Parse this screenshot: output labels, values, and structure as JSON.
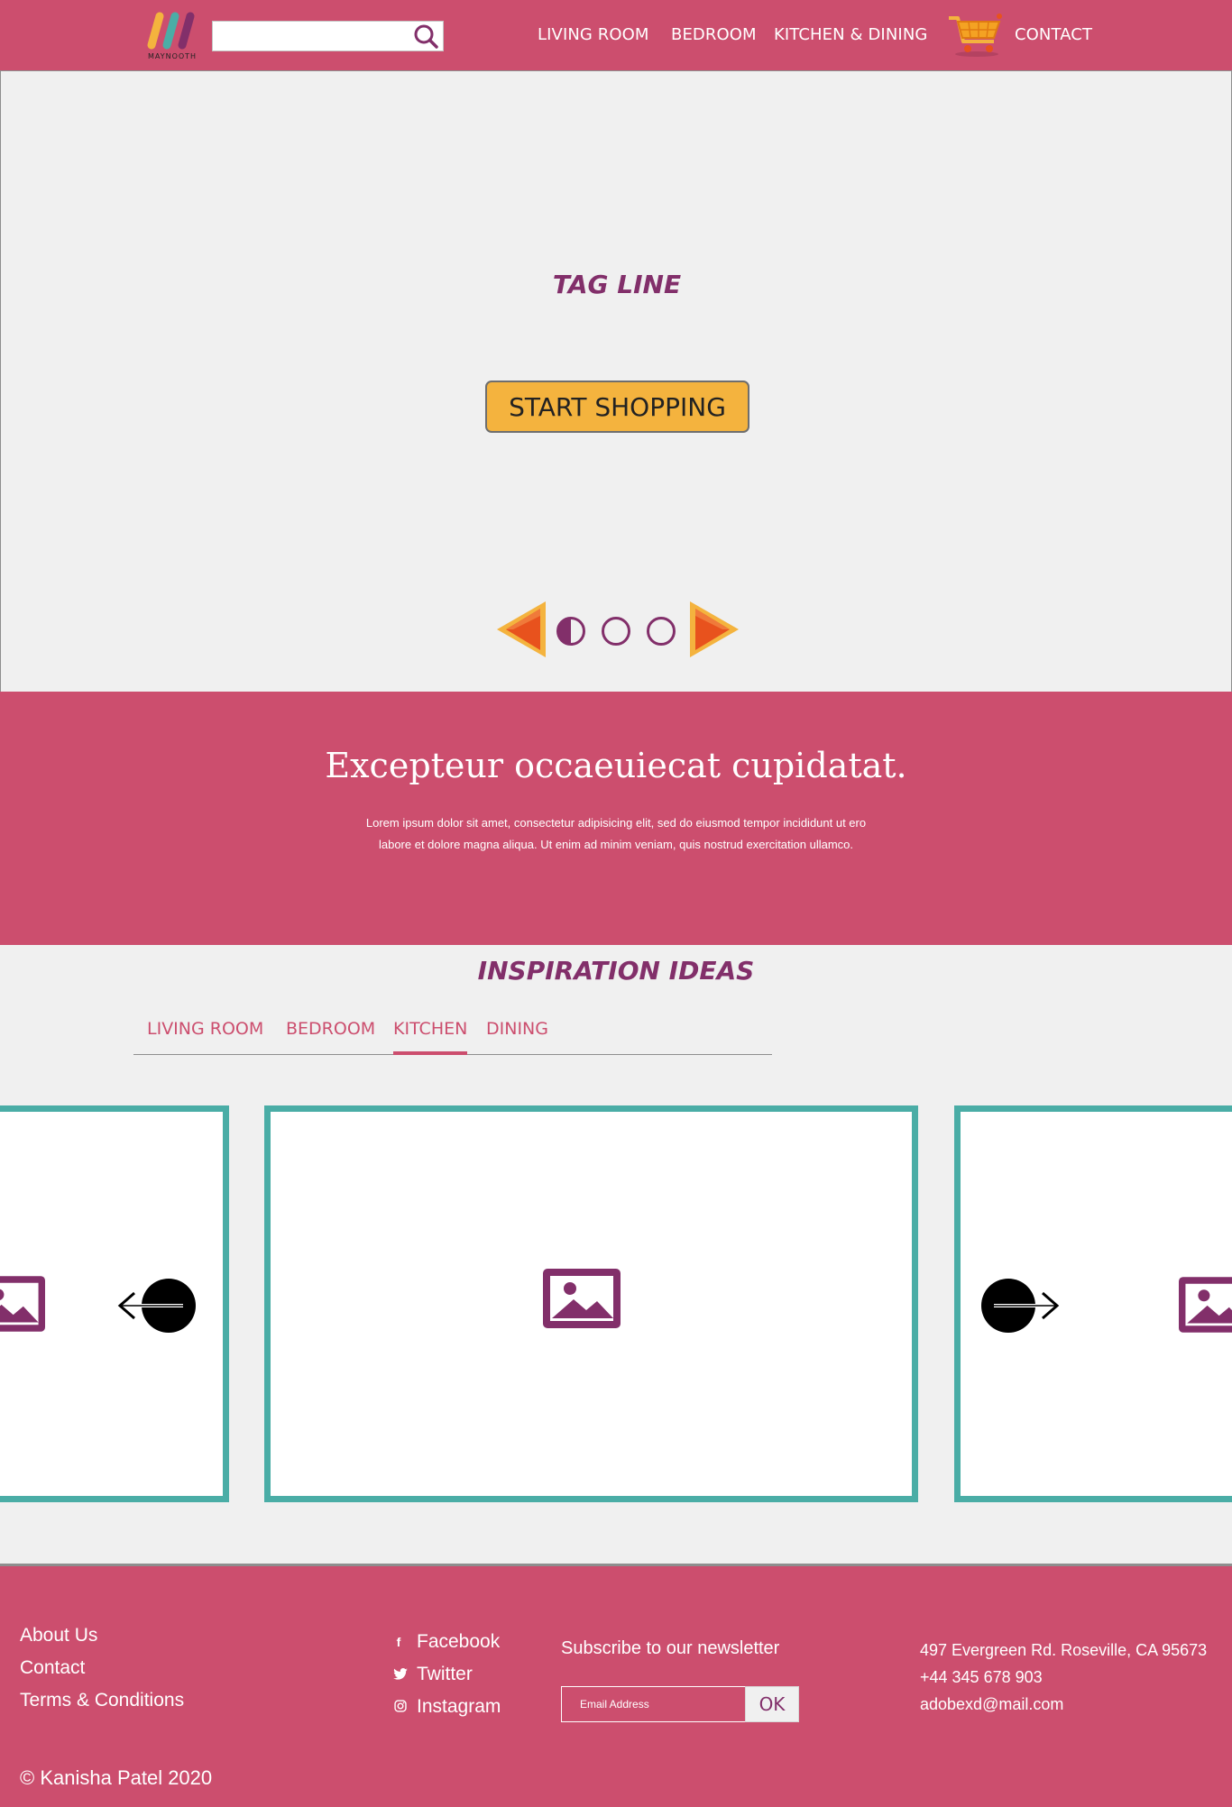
{
  "header": {
    "logo_text": "MAYNOOTH",
    "search_placeholder": "",
    "nav": [
      "LIVING ROOM",
      "BEDROOM",
      "KITCHEN & DINING"
    ],
    "contact_label": "CONTACT"
  },
  "hero": {
    "tagline": "TAG LINE",
    "cta_label": "START SHOPPING",
    "slide_count": 3,
    "active_slide": 1
  },
  "promo": {
    "title": "Excepteur occaeuiecat cupidatat.",
    "body": "Lorem ipsum dolor sit amet, consectetur adipisicing elit, sed do eiusmod tempor incididunt ut ero labore et dolore magna aliqua. Ut enim ad minim veniam, quis nostrud exercitation ullamco."
  },
  "inspiration": {
    "title": "INSPIRATION IDEAS",
    "tabs": [
      "LIVING ROOM",
      "BEDROOM",
      "KITCHEN",
      "DINING"
    ],
    "active_tab": "KITCHEN"
  },
  "footer": {
    "links": [
      "About Us",
      "Contact",
      "Terms & Conditions"
    ],
    "social": [
      {
        "label": "Facebook",
        "icon": "facebook-icon"
      },
      {
        "label": "Twitter",
        "icon": "twitter-icon"
      },
      {
        "label": "Instagram",
        "icon": "instagram-icon"
      }
    ],
    "newsletter_label": "Subscribe to our newsletter",
    "email_placeholder": "Email Address",
    "ok_label": "OK",
    "address": "497 Evergreen Rd. Roseville, CA 95673",
    "phone": "+44 345 678 903",
    "email": "adobexd@mail.com",
    "copyright": "© Kanisha Patel 2020"
  },
  "colors": {
    "brand_pink": "#cc4e6e",
    "brand_purple": "#822f6a",
    "accent_yellow": "#f4b33e",
    "card_border_teal": "#4aada6",
    "page_background": "#f0f0f0"
  }
}
